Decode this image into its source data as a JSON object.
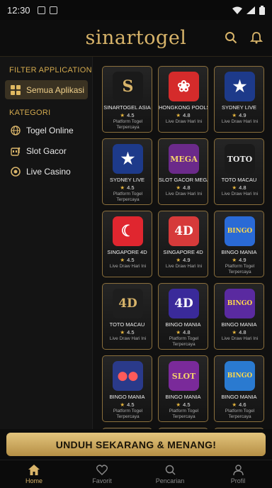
{
  "status": {
    "time": "12:30"
  },
  "header": {
    "brand": "sinartogel"
  },
  "sidebar": {
    "filter_title": "FILTER APPLICATION",
    "filter_item": "Semua Aplikasi",
    "category_title": "KATEGORI",
    "categories": [
      {
        "label": "Togel Online",
        "icon": "globe-icon"
      },
      {
        "label": "Slot Gacor",
        "icon": "slot-machine-icon"
      },
      {
        "label": "Live Casino",
        "icon": "casino-chip-icon"
      }
    ]
  },
  "apps": [
    {
      "name": "SINARTOGEL ASIA",
      "rating": "4.5",
      "desc": "Platform Togel Terpercaya",
      "logo": "S",
      "icon": "sinartogel-logo-icon",
      "bg": "#1a1a1a",
      "fg": "#d8b46a"
    },
    {
      "name": "HONGKONG POOLS",
      "rating": "4.8",
      "desc": "Live Draw Hari Ini",
      "logo": "❀",
      "icon": "hongkong-flag-icon",
      "bg": "#d52b2b",
      "fg": "#ffffff"
    },
    {
      "name": "SYDNEY LIVE",
      "rating": "4.9",
      "desc": "Live Draw Hari Ini",
      "logo": "★",
      "icon": "australia-flag-icon",
      "bg": "#1d3a8a",
      "fg": "#ffffff"
    },
    {
      "name": "SYDNEY LIVE",
      "rating": "4.5",
      "desc": "Platform Togel Terpercaya",
      "logo": "★",
      "icon": "australia-flag-icon",
      "bg": "#1d3a8a",
      "fg": "#ffffff"
    },
    {
      "name": "SLOT GACOR MEGA",
      "rating": "4.8",
      "desc": "Live Draw Hari Ini",
      "logo": "MEGA",
      "icon": "slot-mega-icon",
      "bg": "#6b2a8a",
      "fg": "#f5d36b"
    },
    {
      "name": "TOTO MACAU",
      "rating": "4.8",
      "desc": "Live Draw Hari Ini",
      "logo": "TOTO",
      "icon": "toto-macau-icon",
      "bg": "#1a1a1a",
      "fg": "#e8e8e8"
    },
    {
      "name": "SINGAPORE 4D",
      "rating": "4.5",
      "desc": "Live Draw Hari Ini",
      "logo": "☾",
      "icon": "singapore-flag-icon",
      "bg": "#e0262f",
      "fg": "#ffffff"
    },
    {
      "name": "SINGAPORE 4D",
      "rating": "4.9",
      "desc": "Live Draw Hari Ini",
      "logo": "4D",
      "icon": "4d-icon",
      "bg": "#d63a3a",
      "fg": "#ffffff"
    },
    {
      "name": "BINGO MANIA",
      "rating": "4.9",
      "desc": "Platform Togel Terpercaya",
      "logo": "BINGO",
      "icon": "bingo-icon",
      "bg": "#2a6ad6",
      "fg": "#ffd84a"
    },
    {
      "name": "TOTO MACAU",
      "rating": "4.5",
      "desc": "Live Draw Hari Ini",
      "logo": "4D",
      "icon": "toto-4d-icon",
      "bg": "#1e1e1e",
      "fg": "#d8b46a"
    },
    {
      "name": "BINGO MANIA",
      "rating": "4.8",
      "desc": "Platform Togel Terpercaya",
      "logo": "4D",
      "icon": "bingo-4d-icon",
      "bg": "#3a2a9a",
      "fg": "#ffffff"
    },
    {
      "name": "BINGO MANIA",
      "rating": "4.8",
      "desc": "Live Draw Hari Ini",
      "logo": "BINGO",
      "icon": "bingo-balls-icon",
      "bg": "#5a2aa0",
      "fg": "#ffd84a"
    },
    {
      "name": "BINGO MANIA",
      "rating": "4.5",
      "desc": "Platform Togel Terpercaya",
      "logo": "●●",
      "icon": "lottery-balls-icon",
      "bg": "#2a3a8a",
      "fg": "#ff5a5a"
    },
    {
      "name": "BINGO MANIA",
      "rating": "4.5",
      "desc": "Platform Togel Terpercaya",
      "logo": "SLOT",
      "icon": "slot-bingo-icon",
      "bg": "#7a2a9a",
      "fg": "#f5d36b"
    },
    {
      "name": "BINGO MANIA",
      "rating": "4.6",
      "desc": "Platform Togel Terpercaya",
      "logo": "BINGO",
      "icon": "bingo-mania-icon",
      "bg": "#2a7ad0",
      "fg": "#ffd84a"
    }
  ],
  "cta": {
    "label": "UNDUH SEKARANG & MENANG!"
  },
  "bottom_nav": [
    {
      "label": "Home",
      "icon": "home-icon"
    },
    {
      "label": "Favorit",
      "icon": "heart-icon"
    },
    {
      "label": "Pencarian",
      "icon": "search-icon"
    },
    {
      "label": "Profil",
      "icon": "profile-icon"
    }
  ],
  "colors": {
    "accent": "#d8b46a",
    "background": "#0b0b0b",
    "card_border": "#8a6f3c"
  }
}
